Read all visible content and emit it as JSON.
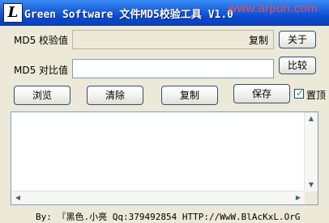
{
  "window": {
    "app_icon_glyph": "L",
    "title": "Green Software 文件MD5校验工具 V1.0",
    "watermark": "www.arpun.com"
  },
  "rows": {
    "md5_label": "MD5 校验值",
    "md5_inline_copy": "复制",
    "about_button": "关于",
    "compare_label": "MD5 对比值",
    "compare_value": "",
    "compare_button": "比较"
  },
  "actions": {
    "browse": "浏览",
    "clear": "清除",
    "copy": "复制",
    "save": "保存",
    "on_top_label": "置顶",
    "on_top_checked": true
  },
  "output": {
    "text": ""
  },
  "footer": {
    "text": "By: 『黑色.小亮 Qq:379492854  HTTP://WwW.BlAcKxL.OrG"
  },
  "colors": {
    "title_bar": "#0a4bd0",
    "checkbox_mark": "#21a121",
    "watermark": "#ff4d4d"
  }
}
